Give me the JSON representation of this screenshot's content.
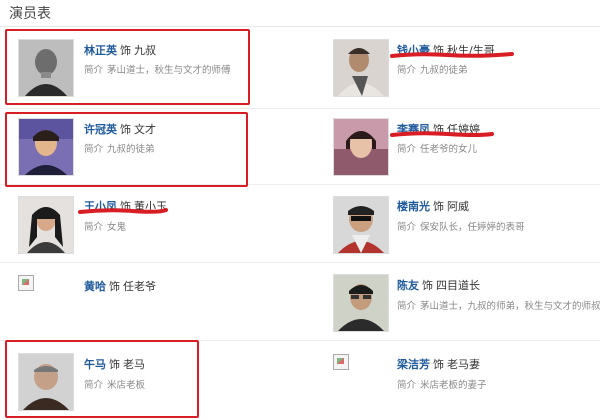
{
  "page_title": "演员表",
  "desc_label": "简介",
  "role_prefix": "饰",
  "cast": [
    {
      "name": "林正英",
      "role": "九叔",
      "desc": "茅山道士，秋生与文才的师傅"
    },
    {
      "name": "钱小豪",
      "role": "秋生/生哥",
      "desc": "九叔的徒弟"
    },
    {
      "name": "许冠英",
      "role": "文才",
      "desc": "九叔的徒弟"
    },
    {
      "name": "李赛凤",
      "role": "任婷婷",
      "desc": "任老爷的女儿"
    },
    {
      "name": "王小凤",
      "role": "董小玉",
      "desc": "女鬼"
    },
    {
      "name": "楼南光",
      "role": "阿威",
      "desc": "保安队长，任婷婷的表哥"
    },
    {
      "name": "黄哈",
      "role": "任老爷",
      "desc": ""
    },
    {
      "name": "陈友",
      "role": "四目道长",
      "desc": "茅山道士，九叔的师弟，秋生与文才的师叔"
    },
    {
      "name": "午马",
      "role": "老马",
      "desc": "米店老板"
    },
    {
      "name": "梁洁芳",
      "role": "老马妻",
      "desc": "米店老板的妻子"
    }
  ],
  "colors": {
    "link": "#1f5a9c",
    "highlight": "#d81e24",
    "muted": "#888888"
  }
}
